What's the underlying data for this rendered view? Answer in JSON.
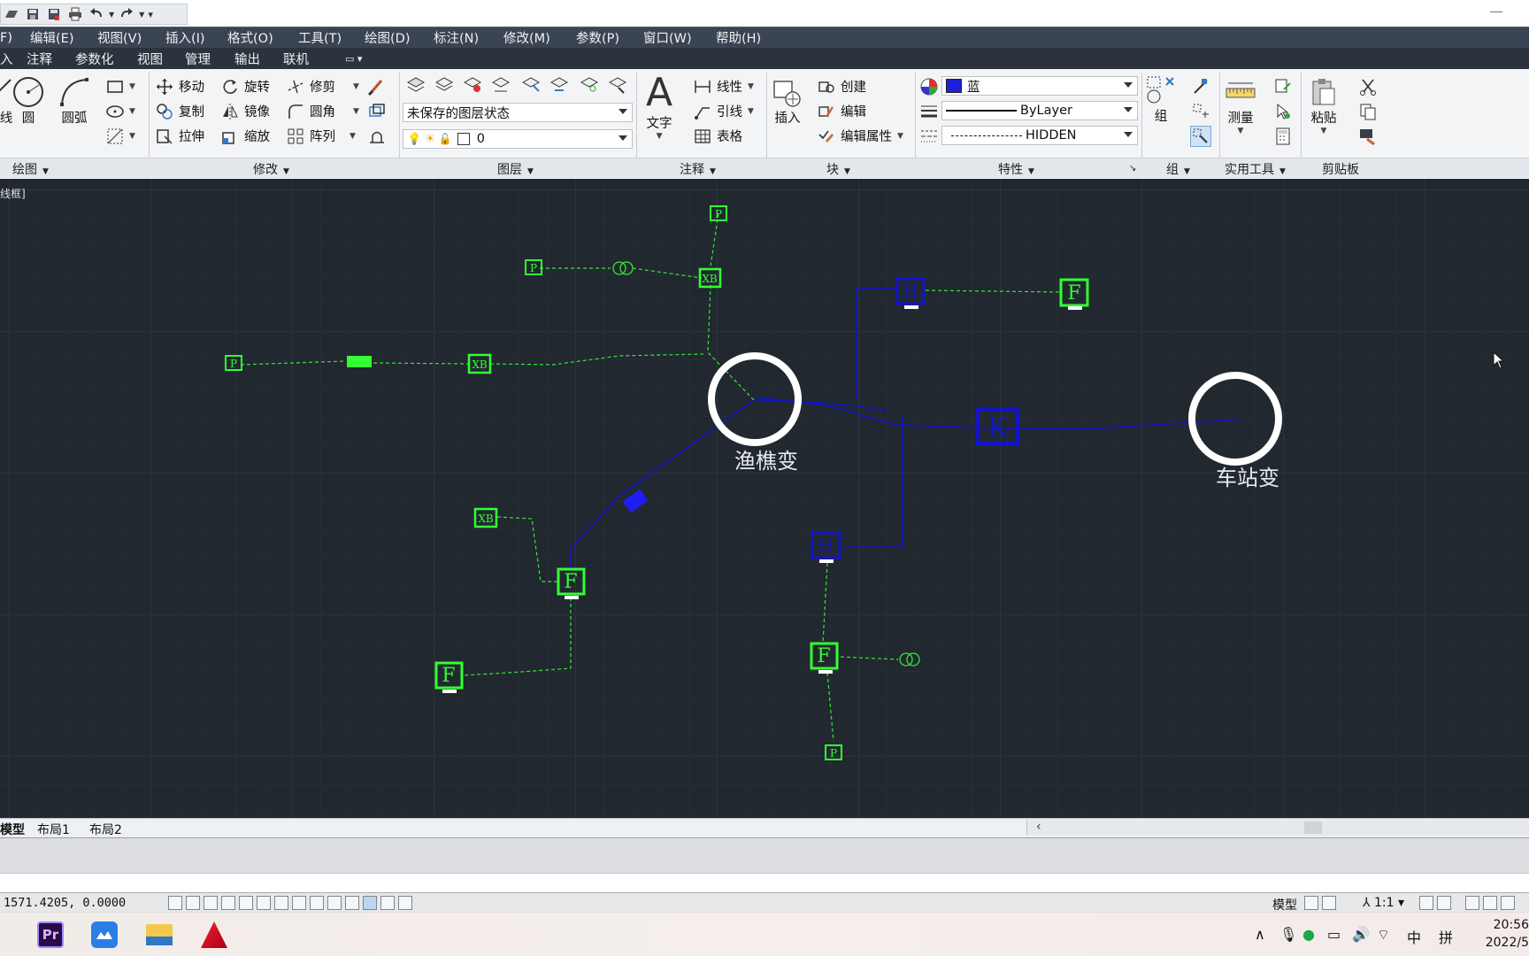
{
  "menubar": {
    "items": [
      "F)",
      "编辑(E)",
      "视图(V)",
      "插入(I)",
      "格式(O)",
      "工具(T)",
      "绘图(D)",
      "标注(N)",
      "修改(M)",
      "参数(P)",
      "窗口(W)",
      "帮助(H)"
    ]
  },
  "ribbon_tabs": {
    "items": [
      "入",
      "注释",
      "参数化",
      "视图",
      "管理",
      "输出",
      "联机"
    ]
  },
  "ribbon": {
    "draw": {
      "title": "绘图",
      "circle": "圆",
      "arc": "圆弧",
      "line_partial": "线"
    },
    "modify": {
      "title": "修改",
      "move": "移动",
      "rotate": "旋转",
      "trim": "修剪",
      "copy": "复制",
      "mirror": "镜像",
      "fillet": "圆角",
      "stretch": "拉伸",
      "scale": "缩放",
      "array": "阵列"
    },
    "layers": {
      "title": "图层",
      "layer_state": "未保存的图层状态",
      "current_layer": "0"
    },
    "annotation": {
      "title": "注释",
      "text": "文字",
      "linear": "线性",
      "leader": "引线",
      "table": "表格"
    },
    "block": {
      "title": "块",
      "insert": "插入",
      "create": "创建",
      "edit": "编辑",
      "edit_attributes": "编辑属性"
    },
    "properties": {
      "title": "特性",
      "color": "蓝",
      "color_hex": "#1f1fd8",
      "lineweight": "ByLayer",
      "linetype": "HIDDEN"
    },
    "groups": {
      "title": "组",
      "group": "组"
    },
    "utilities": {
      "title": "实用工具",
      "measure": "测量"
    },
    "clipboard": {
      "title": "剪贴板",
      "paste": "粘贴"
    }
  },
  "canvas": {
    "viewport_label": "线框]",
    "substations": [
      "渔樵变",
      "车站变"
    ],
    "node_labels": {
      "green_f": "F",
      "green_p": "P",
      "green_xb": "XB",
      "blue_k": "K",
      "blue_h": "H"
    },
    "colors": {
      "green": "#33ff33",
      "blue": "#1414c8",
      "circle": "#ffffff"
    }
  },
  "layout_tabs": [
    "模型",
    "布局1",
    "布局2"
  ],
  "statusbar": {
    "coords": "1571.4205, 0.0000",
    "model": "模型",
    "scale": "1:1"
  },
  "taskbar": {
    "time": "20:56",
    "date": "2022/5",
    "ime_lang": "中",
    "ime_mode": "拼",
    "apps": [
      "Premiere Pro",
      "Baidu Netdisk",
      "File Explorer",
      "AutoCAD"
    ]
  }
}
